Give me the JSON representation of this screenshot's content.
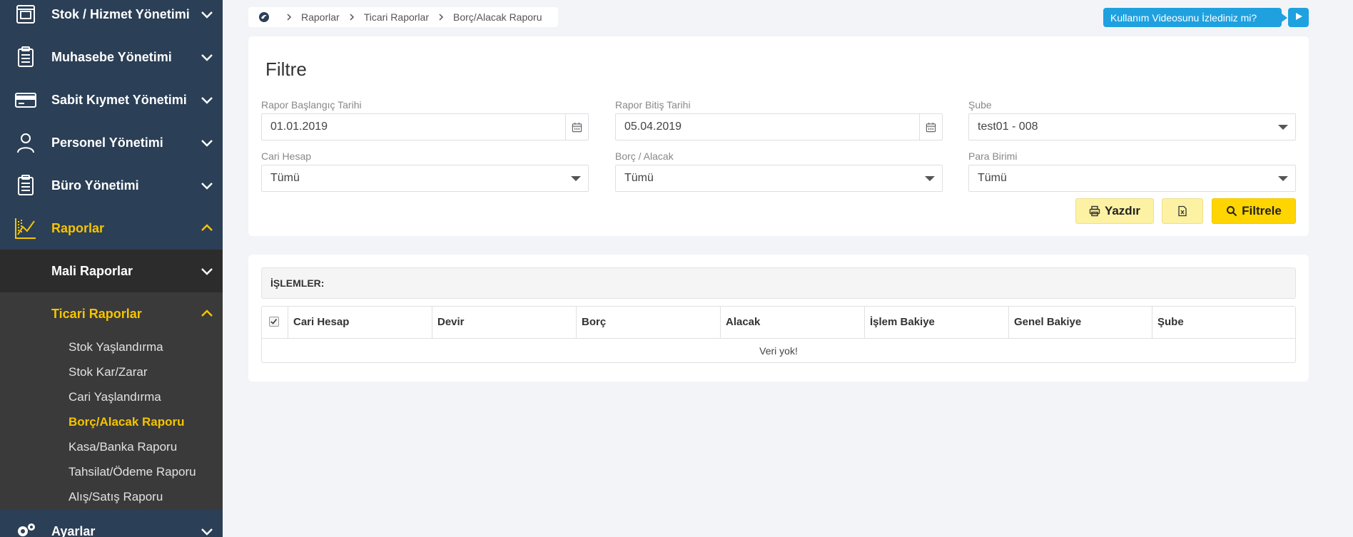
{
  "sidebar": {
    "items": [
      {
        "label": "Stok / Hizmet Yönetimi",
        "icon": "inventory-icon"
      },
      {
        "label": "Muhasebe Yönetimi",
        "icon": "clipboard-icon"
      },
      {
        "label": "Sabit Kıymet Yönetimi",
        "icon": "credit-card-icon"
      },
      {
        "label": "Personel Yönetimi",
        "icon": "person-icon"
      },
      {
        "label": "Büro Yönetimi",
        "icon": "clipboard-icon"
      },
      {
        "label": "Raporlar",
        "icon": "chart-icon",
        "active": true
      }
    ],
    "sub": {
      "mali": "Mali Raporlar",
      "ticari": "Ticari Raporlar"
    },
    "leaves": [
      "Stok Yaşlandırma",
      "Stok Kar/Zarar",
      "Cari Yaşlandırma",
      "Borç/Alacak Raporu",
      "Kasa/Banka Raporu",
      "Tahsilat/Ödeme Raporu",
      "Alış/Satış Raporu"
    ],
    "active_leaf": "Borç/Alacak Raporu",
    "settings": "Ayarlar",
    "colors": {
      "bg": "#2b3f56",
      "accent": "#f5c400"
    }
  },
  "breadcrumb": {
    "items": [
      "Raporlar",
      "Ticari Raporlar",
      "Borç/Alacak Raporu"
    ]
  },
  "video_button": "Kullanım Videosunu İzlediniz mi?",
  "filter": {
    "title": "Filtre",
    "start_date": {
      "label": "Rapor Başlangıç Tarihi",
      "value": "01.01.2019"
    },
    "end_date": {
      "label": "Rapor Bitiş Tarihi",
      "value": "05.04.2019"
    },
    "branch": {
      "label": "Şube",
      "value": "test01 - 008"
    },
    "account": {
      "label": "Cari Hesap",
      "value": "Tümü"
    },
    "debt_credit": {
      "label": "Borç / Alacak",
      "value": "Tümü"
    },
    "currency": {
      "label": "Para Birimi",
      "value": "Tümü"
    },
    "print_label": "Yazdır",
    "filter_label": "Filtrele"
  },
  "table": {
    "section_title": "İŞLEMLER:",
    "columns": [
      "Cari Hesap",
      "Devir",
      "Borç",
      "Alacak",
      "İşlem Bakiye",
      "Genel Bakiye",
      "Şube"
    ],
    "empty_text": "Veri yok!"
  }
}
